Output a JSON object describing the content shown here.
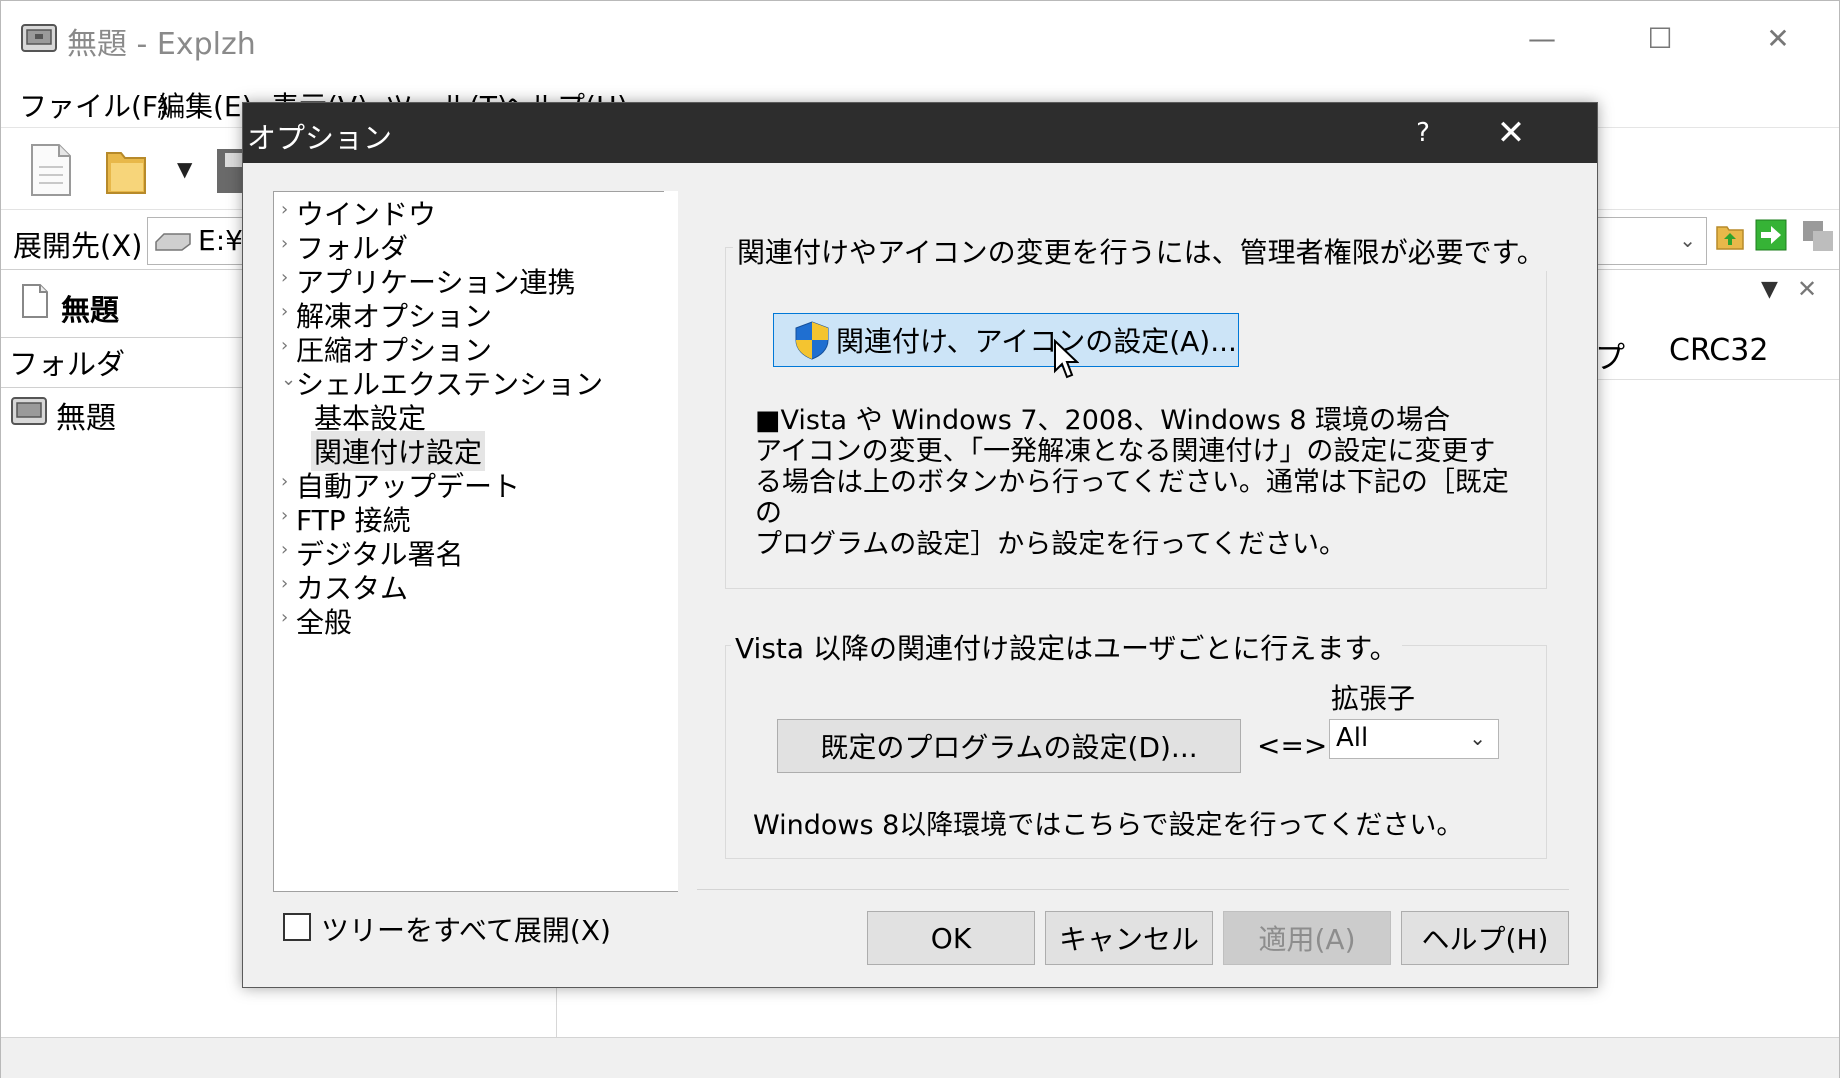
{
  "app": {
    "title": "無題 - Explzh"
  },
  "window_controls": {
    "minimize": "—",
    "maximize": "☐",
    "close": "✕"
  },
  "menubar": {
    "items": [
      "ファイル(F)",
      "編集(E)",
      "表示(V)",
      "ツール(T)",
      "ヘルプ(H)"
    ]
  },
  "address": {
    "label": "展開先(X)",
    "value": "E:¥"
  },
  "left_pane": {
    "tab_label": "無題",
    "folder_header": "フォルダ",
    "tree_root": "無題"
  },
  "list_header": {
    "partial_col": "プ",
    "crc_col": "CRC32"
  },
  "dialog": {
    "title": "オプション",
    "help": "?",
    "close": "✕",
    "tree": [
      {
        "label": "ウインドウ",
        "arrow": "›",
        "indent": 0
      },
      {
        "label": "フォルダ",
        "arrow": "›",
        "indent": 0
      },
      {
        "label": "アプリケーション連携",
        "arrow": "›",
        "indent": 0
      },
      {
        "label": "解凍オプション",
        "arrow": "›",
        "indent": 0
      },
      {
        "label": "圧縮オプション",
        "arrow": "›",
        "indent": 0
      },
      {
        "label": "シェルエクステンション",
        "arrow": "⌄",
        "indent": 0
      },
      {
        "label": "基本設定",
        "arrow": "",
        "indent": 1
      },
      {
        "label": "関連付け設定",
        "arrow": "",
        "indent": 1,
        "selected": true
      },
      {
        "label": "自動アップデート",
        "arrow": "›",
        "indent": 0
      },
      {
        "label": "FTP 接続",
        "arrow": "›",
        "indent": 0
      },
      {
        "label": "デジタル署名",
        "arrow": "›",
        "indent": 0
      },
      {
        "label": "カスタム",
        "arrow": "›",
        "indent": 0
      },
      {
        "label": "全般",
        "arrow": "›",
        "indent": 0
      }
    ],
    "expand_all_label": "ツリーをすべて展開(X)",
    "group1": {
      "title": "関連付けやアイコンの変更を行うには、管理者権限が必要です。",
      "button": "関連付け、アイコンの設定(A)...",
      "info_lines": [
        "■Vista や Windows 7、2008、Windows 8 環境の場合",
        "アイコンの変更、「一発解凍となる関連付け」の設定に変更す",
        "る場合は上のボタンから行ってください。通常は下記の［既定の",
        "プログラムの設定］から設定を行ってください。"
      ]
    },
    "group2": {
      "title": "Vista 以降の関連付け設定はユーザごとに行えます。",
      "button": "既定のプログラムの設定(D)...",
      "arrow": "<=>",
      "ext_label": "拡張子",
      "ext_value": "All",
      "note": "Windows 8以降環境ではこちらで設定を行ってください。"
    },
    "buttons": {
      "ok": "OK",
      "cancel": "キャンセル",
      "apply": "適用(A)",
      "help": "ヘルプ(H)"
    }
  }
}
